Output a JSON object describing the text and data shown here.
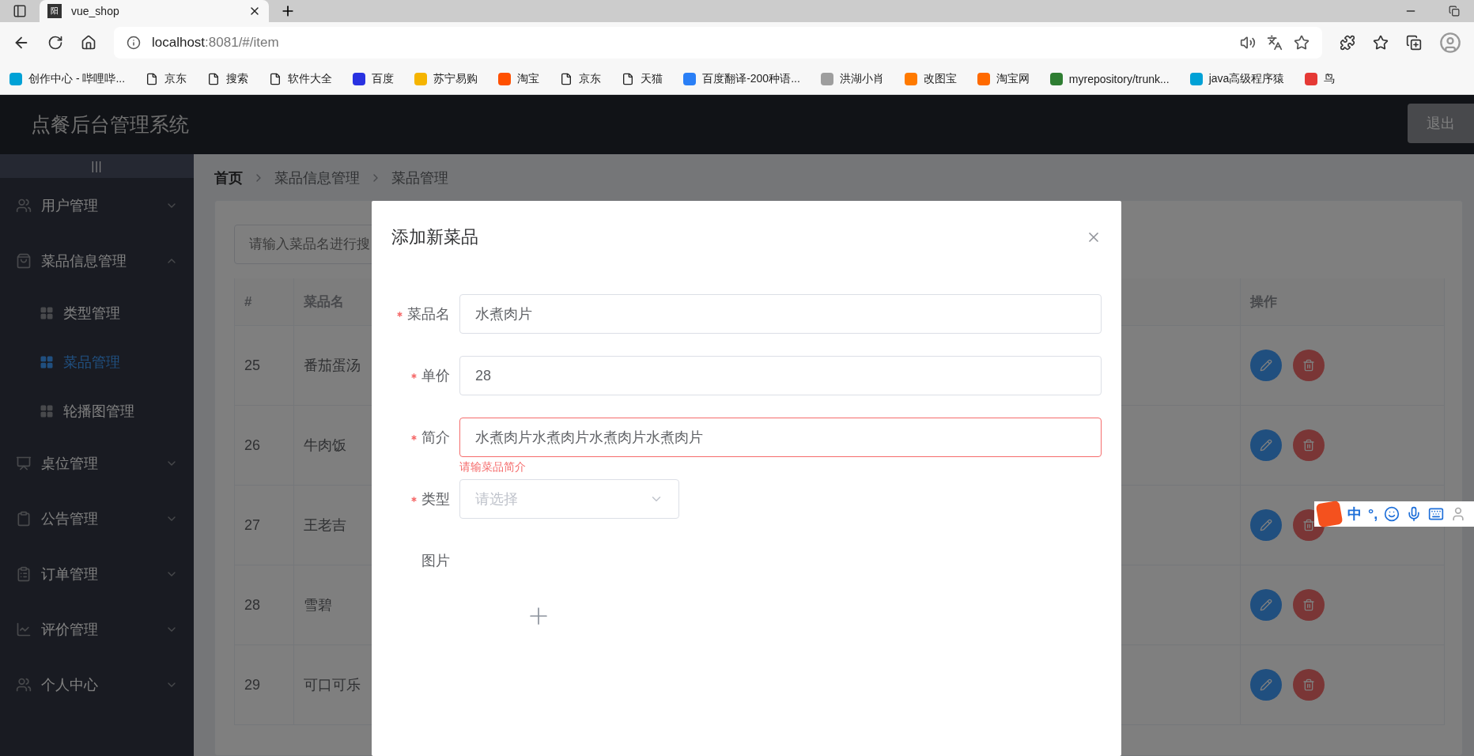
{
  "browser": {
    "tab": {
      "favicon": "阳",
      "title": "vue_shop"
    },
    "address": {
      "host": "localhost",
      "rest": ":8081/#/item"
    },
    "bookmarks": [
      {
        "label": "创作中心 - 哔哩哔...",
        "kind": "logo",
        "color": "#00a1d6"
      },
      {
        "label": "京东",
        "kind": "file"
      },
      {
        "label": "搜索",
        "kind": "file"
      },
      {
        "label": "软件大全",
        "kind": "file"
      },
      {
        "label": "百度",
        "kind": "logo",
        "color": "#2932e1"
      },
      {
        "label": "苏宁易购",
        "kind": "logo",
        "color": "#f5b400"
      },
      {
        "label": "淘宝",
        "kind": "logo",
        "color": "#ff5000"
      },
      {
        "label": "京东",
        "kind": "file"
      },
      {
        "label": "天猫",
        "kind": "file"
      },
      {
        "label": "百度翻译-200种语...",
        "kind": "logo",
        "color": "#2a7ff6"
      },
      {
        "label": "洪湖小肖",
        "kind": "logo",
        "color": "#9e9e9e"
      },
      {
        "label": "改图宝",
        "kind": "logo",
        "color": "#ff7a00"
      },
      {
        "label": "淘宝网",
        "kind": "logo",
        "color": "#ff6a00"
      },
      {
        "label": "myrepository/trunk...",
        "kind": "logo",
        "color": "#2e7d32"
      },
      {
        "label": "java高级程序猿",
        "kind": "logo",
        "color": "#00a1d6"
      },
      {
        "label": "鸟",
        "kind": "logo",
        "color": "#e53935"
      }
    ]
  },
  "header": {
    "title": "点餐后台管理系统",
    "logout": "退出"
  },
  "sidebar": {
    "toggle": "|||",
    "items": [
      {
        "label": "用户管理",
        "kind": "users",
        "expanded": false
      },
      {
        "label": "菜品信息管理",
        "kind": "bag",
        "expanded": true,
        "children": [
          {
            "label": "类型管理",
            "selected": false
          },
          {
            "label": "菜品管理",
            "selected": true
          },
          {
            "label": "轮播图管理",
            "selected": false
          }
        ]
      },
      {
        "label": "桌位管理",
        "kind": "board",
        "expanded": false
      },
      {
        "label": "公告管理",
        "kind": "clipboard",
        "expanded": false
      },
      {
        "label": "订单管理",
        "kind": "list",
        "expanded": false
      },
      {
        "label": "评价管理",
        "kind": "chart",
        "expanded": false
      },
      {
        "label": "个人中心",
        "kind": "users",
        "expanded": false
      }
    ]
  },
  "breadcrumb": [
    "首页",
    "菜品信息管理",
    "菜品管理"
  ],
  "search": {
    "placeholder": "请输入菜品名进行搜"
  },
  "table": {
    "columns": [
      "#",
      "菜品名",
      "操作"
    ],
    "rows": [
      {
        "id": "25",
        "name": "番茄蛋汤"
      },
      {
        "id": "26",
        "name": "牛肉饭"
      },
      {
        "id": "27",
        "name": "王老吉"
      },
      {
        "id": "28",
        "name": "雪碧"
      },
      {
        "id": "29",
        "name": "可口可乐"
      }
    ]
  },
  "dialog": {
    "title": "添加新菜品",
    "fields": [
      {
        "kind": "input",
        "label": "菜品名",
        "required": true,
        "value": "水煮肉片"
      },
      {
        "kind": "input",
        "label": "单价",
        "required": true,
        "value": "28"
      },
      {
        "kind": "input",
        "label": "简介",
        "required": true,
        "value": "水煮肉片水煮肉片水煮肉片水煮肉片",
        "error": "请输菜品简介"
      },
      {
        "kind": "select",
        "label": "类型",
        "required": true,
        "placeholder": "请选择"
      },
      {
        "kind": "upload",
        "label": "图片",
        "required": false
      }
    ]
  },
  "ime_toolbar": {
    "mode": "中",
    "punctuation": "°,"
  }
}
